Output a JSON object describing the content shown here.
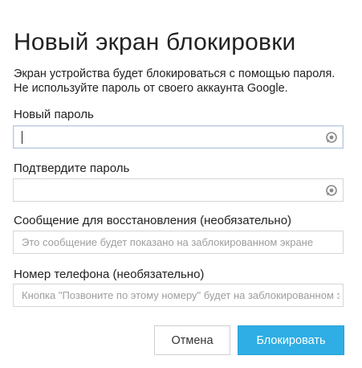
{
  "dialog": {
    "title": "Новый экран блокировки",
    "description_line1": "Экран устройства будет блокироваться с помощью пароля.",
    "description_line2": "Не используйте пароль от своего аккаунта Google."
  },
  "fields": {
    "new_password": {
      "label": "Новый пароль",
      "value": "",
      "icon": "eye-icon"
    },
    "confirm_password": {
      "label": "Подтвердите пароль",
      "value": "",
      "icon": "eye-icon"
    },
    "recovery_message": {
      "label": "Сообщение для восстановления (необязательно)",
      "placeholder": "Это сообщение будет показано на заблокированном экране",
      "value": ""
    },
    "phone_number": {
      "label": "Номер телефона (необязательно)",
      "placeholder": "Кнопка \"Позвоните по этому номеру\" будет на заблокированном экране",
      "value": ""
    }
  },
  "buttons": {
    "cancel_label": "Отмена",
    "lock_label": "Блокировать"
  },
  "colors": {
    "accent": "#2eaee4",
    "text": "#222222",
    "placeholder": "#9e9e9e",
    "border": "#d6d6d6"
  }
}
